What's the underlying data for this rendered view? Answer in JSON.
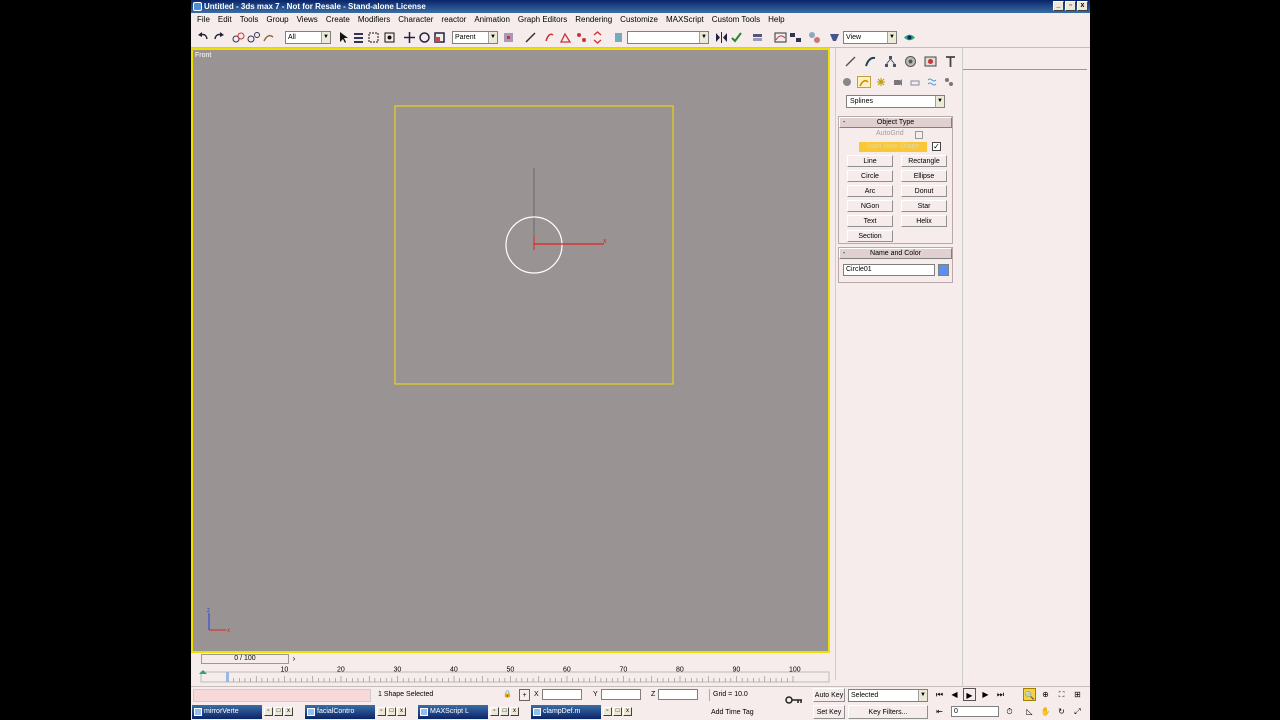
{
  "window": {
    "title": "Untitled - 3ds max 7 - Not for Resale - Stand-alone License",
    "controls": [
      "_",
      "▫",
      "x"
    ]
  },
  "menu": [
    "File",
    "Edit",
    "Tools",
    "Group",
    "Views",
    "Create",
    "Modifiers",
    "Character",
    "reactor",
    "Animation",
    "Graph Editors",
    "Rendering",
    "Customize",
    "MAXScript",
    "Custom Tools",
    "Help"
  ],
  "toolbar": {
    "selection_filter": "All",
    "reference_coord": "Parent",
    "named_selection": "",
    "render_type": "View"
  },
  "viewport": {
    "label": "Front",
    "axis_z": "z",
    "axis_x": "x",
    "gizmo_x": "x"
  },
  "command_panel": {
    "category": "Splines",
    "object_type_title": "Object Type",
    "autogrid_label": "AutoGrid",
    "start_new_shape_label": "Start New Shape",
    "buttons": [
      "Line",
      "Rectangle",
      "Circle",
      "Ellipse",
      "Arc",
      "Donut",
      "NGon",
      "Star",
      "Text",
      "Helix",
      "Section"
    ],
    "name_color_title": "Name and Color",
    "object_name": "Circle01",
    "object_color": "#5b8ff0"
  },
  "time_slider": {
    "frame_display": "0 / 100",
    "ticks": [
      "10",
      "20",
      "30",
      "40",
      "50",
      "60",
      "70",
      "80",
      "90",
      "100"
    ]
  },
  "status": {
    "selection_text": "1 Shape Selected",
    "x_label": "X",
    "y_label": "Y",
    "z_label": "Z",
    "grid_text": "Grid = 10.0",
    "add_time_tag": "Add Time Tag",
    "auto_key": "Auto Key",
    "set_key": "Set Key",
    "selected_dropdown": "Selected",
    "key_filters": "Key Filters...",
    "frame_value": "0"
  },
  "taskbar": [
    "mirrorVerte",
    "facialContro",
    "MAXScript L",
    "clampDef.m"
  ],
  "colors": {
    "viewport_bg": "#9a9393",
    "viewport_border": "#f0e000",
    "panel_bg": "#f6ecec",
    "start_new_shape_bg": "#f8c838",
    "spline_white": "#ffffff",
    "gizmo_red": "#e02020"
  }
}
